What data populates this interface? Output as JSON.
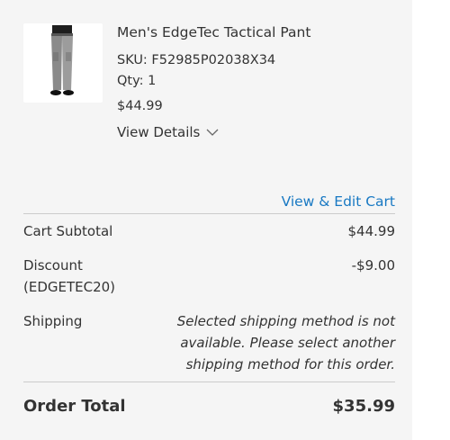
{
  "product": {
    "name": "Men's EdgeTec Tactical Pant",
    "sku": "SKU: F52985P02038X34",
    "qty": "Qty: 1",
    "price": "$44.99",
    "details_label": "View Details",
    "image_icon": "pants-product-image"
  },
  "cart": {
    "view_edit_label": "View & Edit Cart"
  },
  "totals": {
    "subtotal_label": "Cart Subtotal",
    "subtotal_value": "$44.99",
    "discount_label_line1": "Discount",
    "discount_label_line2": "(EDGETEC20)",
    "discount_value": "-$9.00",
    "shipping_label": "Shipping",
    "shipping_message": "Selected shipping method is not available. Please select another shipping method for this order.",
    "order_total_label": "Order Total",
    "order_total_value": "$35.99"
  },
  "colors": {
    "link": "#1979c3",
    "panel_bg": "#f5f5f5",
    "text": "#333333",
    "divider": "#cccccc"
  }
}
